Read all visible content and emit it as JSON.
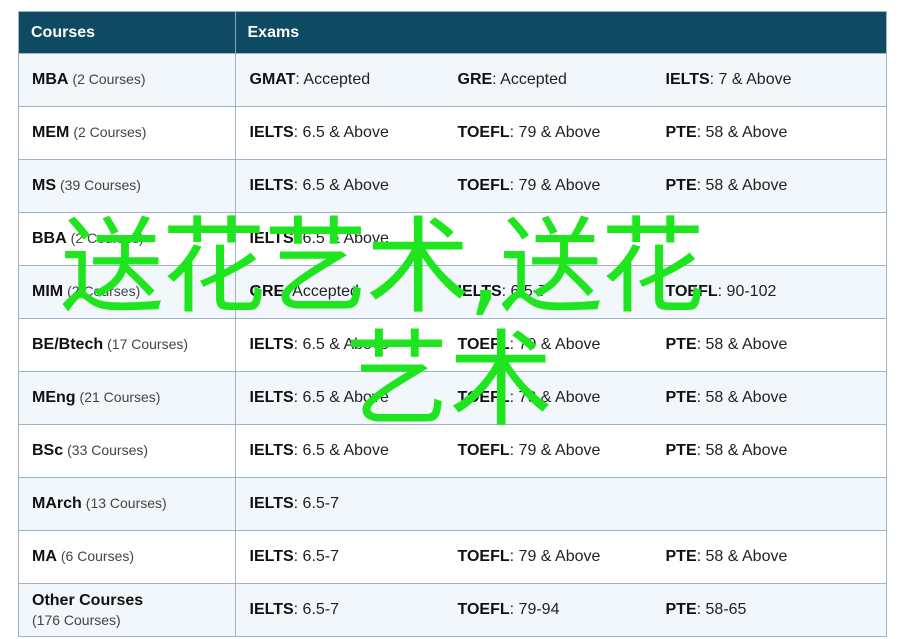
{
  "table": {
    "headers": {
      "courses": "Courses",
      "exams": "Exams"
    },
    "rows": [
      {
        "course": "MBA",
        "count": "(2 Courses)",
        "exams": [
          {
            "name": "GMAT",
            "score": ": Accepted"
          },
          {
            "name": "GRE",
            "score": ": Accepted"
          },
          {
            "name": "IELTS",
            "score": ": 7 & Above"
          }
        ]
      },
      {
        "course": "MEM",
        "count": "(2 Courses)",
        "exams": [
          {
            "name": "IELTS",
            "score": ": 6.5 & Above"
          },
          {
            "name": "TOEFL",
            "score": ": 79 & Above"
          },
          {
            "name": "PTE",
            "score": ": 58 & Above"
          }
        ]
      },
      {
        "course": "MS",
        "count": "(39 Courses)",
        "exams": [
          {
            "name": "IELTS",
            "score": ": 6.5 & Above"
          },
          {
            "name": "TOEFL",
            "score": ": 79 & Above"
          },
          {
            "name": "PTE",
            "score": ": 58 & Above"
          }
        ]
      },
      {
        "course": "BBA",
        "count": "(2 Courses)",
        "exams": [
          {
            "name": "IELTS",
            "score": ": 6.5 & Above"
          }
        ]
      },
      {
        "course": "MIM",
        "count": "(2 Courses)",
        "exams": [
          {
            "name": "GRE",
            "score": ": Accepted"
          },
          {
            "name": "IELTS",
            "score": ": 6.5-7"
          },
          {
            "name": "TOEFL",
            "score": ": 90-102"
          }
        ]
      },
      {
        "course": "BE/Btech",
        "count": "(17 Courses)",
        "exams": [
          {
            "name": "IELTS",
            "score": ": 6.5 & Above"
          },
          {
            "name": "TOEFL",
            "score": ": 79 & Above"
          },
          {
            "name": "PTE",
            "score": ": 58 & Above"
          }
        ]
      },
      {
        "course": "MEng",
        "count": "(21 Courses)",
        "exams": [
          {
            "name": "IELTS",
            "score": ": 6.5 & Above"
          },
          {
            "name": "TOEFL",
            "score": ": 79 & Above"
          },
          {
            "name": "PTE",
            "score": ": 58 & Above"
          }
        ]
      },
      {
        "course": "BSc",
        "count": "(33 Courses)",
        "exams": [
          {
            "name": "IELTS",
            "score": ": 6.5 & Above"
          },
          {
            "name": "TOEFL",
            "score": ": 79 & Above"
          },
          {
            "name": "PTE",
            "score": ": 58 & Above"
          }
        ]
      },
      {
        "course": "MArch",
        "count": "(13 Courses)",
        "exams": [
          {
            "name": "IELTS",
            "score": ": 6.5-7"
          }
        ]
      },
      {
        "course": "MA",
        "count": "(6 Courses)",
        "exams": [
          {
            "name": "IELTS",
            "score": ": 6.5-7"
          },
          {
            "name": "TOEFL",
            "score": ": 79 & Above"
          },
          {
            "name": "PTE",
            "score": ": 58 & Above"
          }
        ]
      },
      {
        "course": "Other Courses",
        "count": "(176 Courses)",
        "count_below": true,
        "exams": [
          {
            "name": "IELTS",
            "score": ": 6.5-7"
          },
          {
            "name": "TOEFL",
            "score": ": 79-94"
          },
          {
            "name": "PTE",
            "score": ": 58-65"
          }
        ]
      }
    ]
  },
  "watermark": {
    "line1": "送花艺术,送花",
    "line2": "艺术",
    "color": "#1ee51e"
  },
  "colors": {
    "header_bg": "#0f4a63",
    "row_alt_bg": "#f2f7fc",
    "border": "#9fb4c8"
  }
}
